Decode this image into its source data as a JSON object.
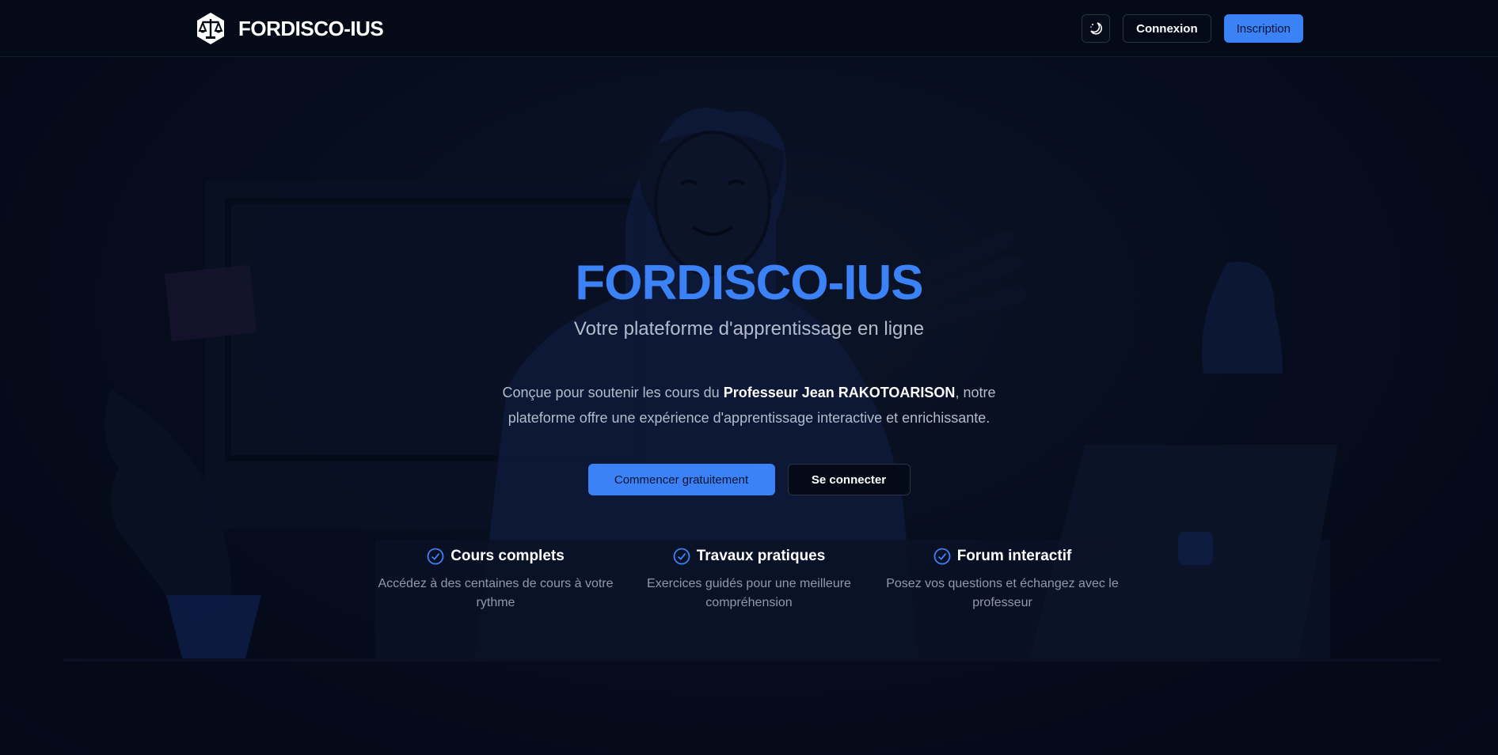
{
  "header": {
    "brand_name": "FORDISCO-IUS",
    "login_label": "Connexion",
    "signup_label": "Inscription"
  },
  "hero": {
    "title": "FORDISCO-IUS",
    "subtitle": "Votre plateforme d'apprentissage en ligne",
    "desc_before": "Conçue pour soutenir les cours du ",
    "desc_bold": "Professeur Jean RAKOTOARISON",
    "desc_after": ", notre plateforme offre une expérience d'apprentissage interactive et enrichissante.",
    "cta_start": "Commencer gratuitement",
    "cta_login": "Se connecter"
  },
  "features": [
    {
      "title": "Cours complets",
      "text": "Accédez à des centaines de cours à votre rythme"
    },
    {
      "title": "Travaux pratiques",
      "text": "Exercices guidés pour une meilleure compréhension"
    },
    {
      "title": "Forum interactif",
      "text": "Posez vos questions et échangez avec le professeur"
    }
  ],
  "colors": {
    "accent": "#3b82f6",
    "background": "#050a18",
    "text_muted": "#b2bccb"
  },
  "icons": {
    "logo": "scales-of-justice-icon",
    "theme": "moon-icon",
    "feature": "check-circle-icon"
  }
}
